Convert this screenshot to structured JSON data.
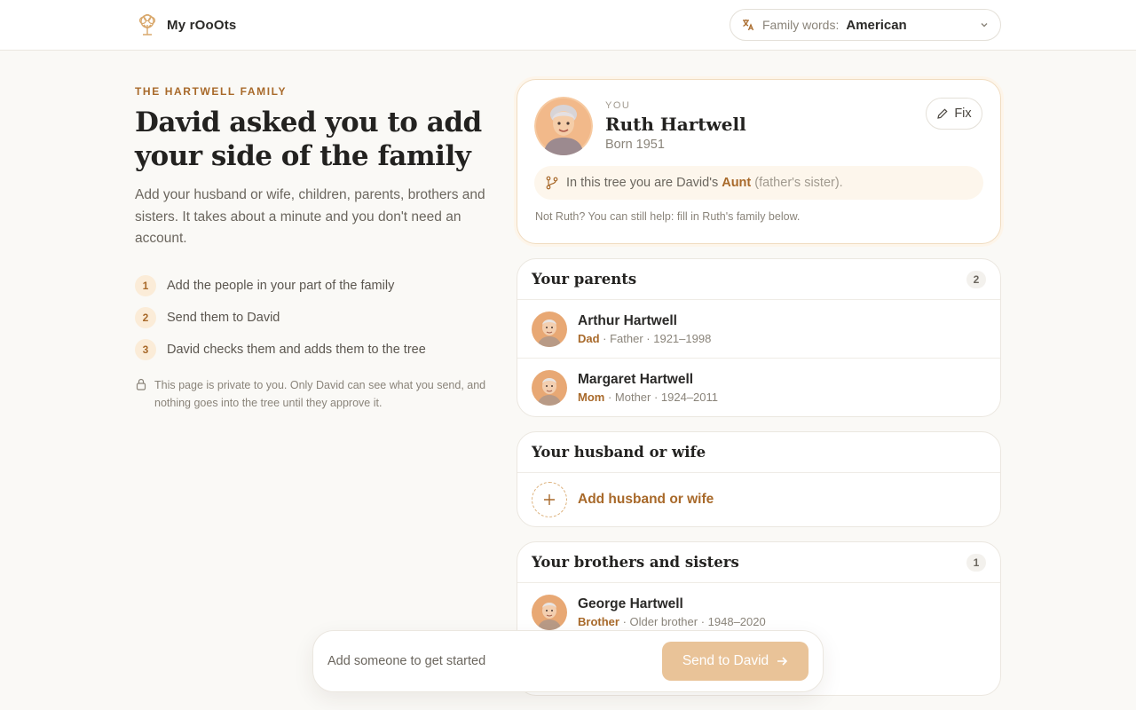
{
  "header": {
    "app_name": "My rOoOts",
    "family_words_label": "Family words:",
    "family_words_value": "American"
  },
  "intro": {
    "eyebrow": "THE HARTWELL FAMILY",
    "headline": "David asked you to add your side of the family",
    "description": "Add your husband or wife, children, parents, brothers and sisters. It takes about a minute and you don't need an account.",
    "steps": [
      {
        "num": "1",
        "text": "Add the people in your part of the family"
      },
      {
        "num": "2",
        "text": "Send them to David"
      },
      {
        "num": "3",
        "text": "David checks them and adds them to the tree"
      }
    ],
    "privacy": "This page is private to you. Only David can see what you send, and nothing goes into the tree until they approve it."
  },
  "you": {
    "tag": "YOU",
    "name": "Ruth Hartwell",
    "born": "Born 1951",
    "fix_label": "Fix",
    "relation_prefix": "In this tree you are David's",
    "relation_role": "Aunt",
    "relation_note": "(father's sister).",
    "not_you": "Not Ruth? You can still help: fill in Ruth's family below."
  },
  "parents": {
    "title": "Your parents",
    "count": "2",
    "people": [
      {
        "name": "Arthur Hartwell",
        "role": "Dad",
        "meta": " · Father · 1921–1998"
      },
      {
        "name": "Margaret Hartwell",
        "role": "Mom",
        "meta": " · Mother · 1924–2011"
      }
    ]
  },
  "spouse": {
    "title": "Your husband or wife",
    "add_label": "Add husband or wife"
  },
  "siblings": {
    "title": "Your brothers and sisters",
    "count": "1",
    "people": [
      {
        "name": "George Hartwell",
        "role": "Brother",
        "meta": " · Older brother · 1948–2020"
      }
    ]
  },
  "send_bar": {
    "text": "Add someone to get started",
    "button": "Send to David"
  },
  "colors": {
    "accent": "#a8692a",
    "accent_soft": "#fbecd8",
    "button_disabled": "#e9c398"
  }
}
